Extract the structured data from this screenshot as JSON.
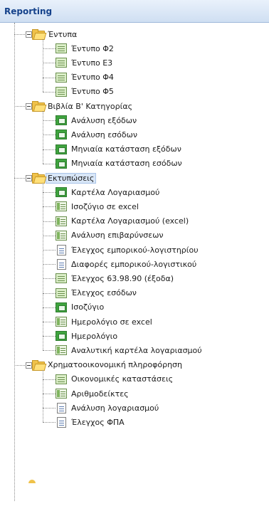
{
  "header": {
    "title": "Reporting"
  },
  "groups": [
    {
      "label": "Έντυπα",
      "expanded": true,
      "items": [
        {
          "label": "Έντυπο Φ2",
          "icon": "form-icon"
        },
        {
          "label": "Έντυπο Ε3",
          "icon": "form-icon"
        },
        {
          "label": "Έντυπο Φ4",
          "icon": "form-icon"
        },
        {
          "label": "Έντυπο Φ5",
          "icon": "form-icon"
        }
      ]
    },
    {
      "label": "Βιβλία Β' Κατηγορίας",
      "expanded": true,
      "items": [
        {
          "label": "Ανάλυση εξόδων",
          "icon": "report-icon"
        },
        {
          "label": "Ανάλυση εσόδων",
          "icon": "report-icon"
        },
        {
          "label": "Μηνιαία κατάσταση εξόδων",
          "icon": "report-icon"
        },
        {
          "label": "Μηνιαία κατάσταση εσόδων",
          "icon": "report-icon"
        }
      ]
    },
    {
      "label": "Εκτυπώσεις",
      "expanded": true,
      "selected": true,
      "items": [
        {
          "label": "Καρτέλα Λογαριασμού",
          "icon": "report-icon"
        },
        {
          "label": "Ισοζύγιο σε excel",
          "icon": "grid-icon"
        },
        {
          "label": "Καρτέλα Λογαριασμού (excel)",
          "icon": "grid-icon"
        },
        {
          "label": "Ανάλυση επιβαρύνσεων",
          "icon": "grid-icon"
        },
        {
          "label": "Έλεγχος εμπορικού-λογιστηρίου",
          "icon": "document-icon"
        },
        {
          "label": "Διαφορές εμπορικού-λογιστικού",
          "icon": "document-icon"
        },
        {
          "label": "Έλεγχος 63.98.90 (έξοδα)",
          "icon": "form-icon"
        },
        {
          "label": "Έλεγχος εσόδων",
          "icon": "form-icon"
        },
        {
          "label": "Ισοζύγιο",
          "icon": "report-icon"
        },
        {
          "label": "Ημερολόγιο σε excel",
          "icon": "grid-icon"
        },
        {
          "label": "Ημερολόγιο",
          "icon": "report-icon"
        },
        {
          "label": "Αναλυτική καρτέλα λογαριασμού",
          "icon": "grid-icon"
        }
      ]
    },
    {
      "label": "Χρηματοοικονομική πληροφόρηση",
      "expanded": true,
      "items": [
        {
          "label": "Οικονομικές καταστάσεις",
          "icon": "form-icon"
        },
        {
          "label": "Αριθμοδείκτες",
          "icon": "grid-icon"
        },
        {
          "label": "Ανάλυση λογαριασμού",
          "icon": "document-icon"
        },
        {
          "label": "Έλεγχος ΦΠΑ",
          "icon": "document-icon"
        }
      ]
    }
  ]
}
